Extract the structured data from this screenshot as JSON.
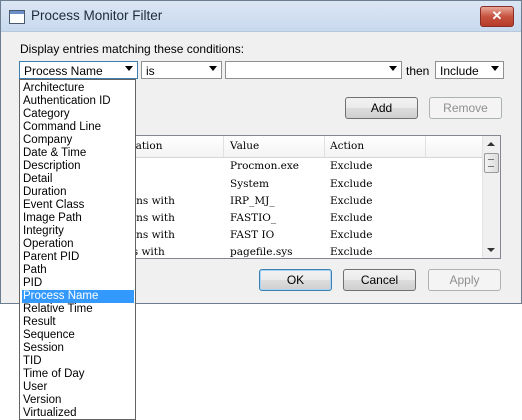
{
  "window": {
    "title": "Process Monitor Filter",
    "close_glyph": "✕"
  },
  "conditions_label": "Display entries matching these conditions:",
  "filter_row": {
    "column_value": "Process Name",
    "relation_value": "is",
    "value_text": "",
    "then_label": "then",
    "action_value": "Include"
  },
  "buttons": {
    "add": "Add",
    "remove": "Remove",
    "ok": "OK",
    "cancel": "Cancel",
    "apply": "Apply"
  },
  "grid": {
    "columns": [
      "elation",
      "Value",
      "Action"
    ],
    "rows": [
      {
        "relation": "",
        "value": "Procmon.exe",
        "action": "Exclude"
      },
      {
        "relation": "",
        "value": "System",
        "action": "Exclude"
      },
      {
        "relation": "gins with",
        "value": "IRP_MJ_",
        "action": "Exclude"
      },
      {
        "relation": "gins with",
        "value": "FASTIO_",
        "action": "Exclude"
      },
      {
        "relation": "gins with",
        "value": "FAST IO",
        "action": "Exclude"
      },
      {
        "relation": "ds with",
        "value": "pagefile.sys",
        "action": "Exclude"
      }
    ]
  },
  "column_options": [
    "Architecture",
    "Authentication ID",
    "Category",
    "Command Line",
    "Company",
    "Date & Time",
    "Description",
    "Detail",
    "Duration",
    "Event Class",
    "Image Path",
    "Integrity",
    "Operation",
    "Parent PID",
    "Path",
    "PID",
    "Process Name",
    "Relative Time",
    "Result",
    "Sequence",
    "Session",
    "TID",
    "Time of Day",
    "User",
    "Version",
    "Virtualized"
  ],
  "selected_option": "Process Name"
}
